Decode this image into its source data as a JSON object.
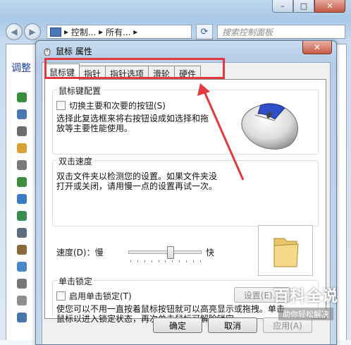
{
  "background_window": {
    "address_parts": [
      "控制...",
      "所有..."
    ],
    "search_placeholder": "搜索控制面板",
    "heading": "调整"
  },
  "dialog": {
    "title": "鼠标 属性",
    "close_glyph": "✕",
    "tabs": [
      {
        "label": "鼠标键",
        "active": true
      },
      {
        "label": "指针",
        "active": false
      },
      {
        "label": "指针选项",
        "active": false
      },
      {
        "label": "滑轮",
        "active": false
      },
      {
        "label": "硬件",
        "active": false
      }
    ],
    "button_config": {
      "group_title": "鼠标键配置",
      "checkbox_label": "切换主要和次要的按钮(S)",
      "checked": false,
      "description": "选择此复选框来将右按钮设成如选择和拖放等主要性能使用。"
    },
    "double_click": {
      "group_title": "双击速度",
      "description": "双击文件夹以检测您的设置。如果文件夹没打开或关闭，请用慢一点的设置再试一次。",
      "speed_label": "速度(D)：慢",
      "fast_label": "快",
      "speed_value": 0.6
    },
    "click_lock": {
      "group_title": "单击锁定",
      "checkbox_label": "启用单击锁定(T)",
      "checked": false,
      "settings_button": "设置(E)...",
      "description": "使您可以不用一直按着鼠标按钮就可以高亮显示或拖拽。单击鼠标以进入锁定状态，再次单击鼠标可解除锁定。"
    },
    "buttons": {
      "ok": "确定",
      "cancel": "取消",
      "apply": "应用(A)"
    }
  },
  "watermark": {
    "main": "百科全说",
    "sub": "助你轻松解决"
  },
  "colors": {
    "highlight_red": "#e3393f",
    "link_blue": "#1e3f9e"
  }
}
